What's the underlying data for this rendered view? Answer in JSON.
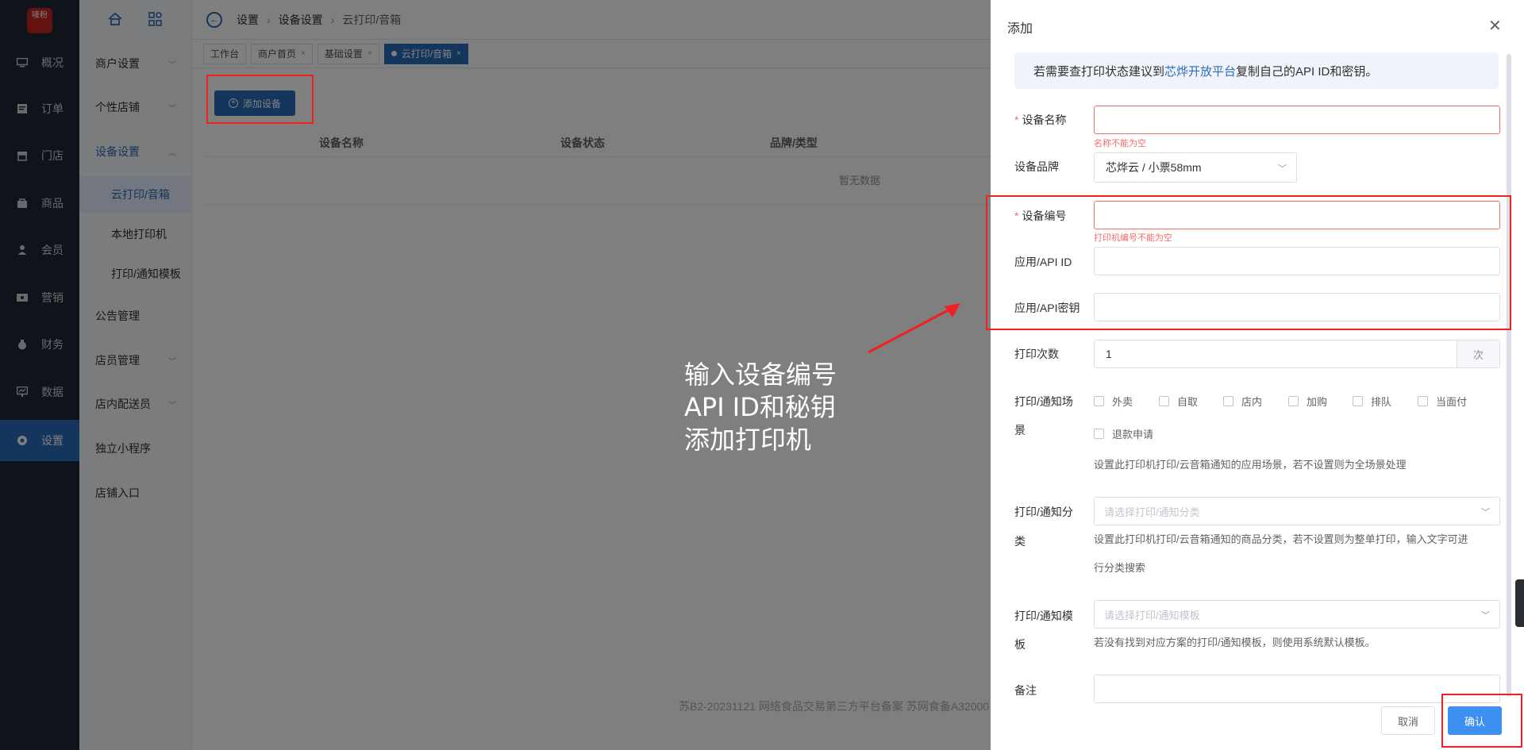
{
  "nav": {
    "logo_text": "唛粉",
    "items": [
      {
        "label": "概况",
        "icon": "monitor-icon"
      },
      {
        "label": "订单",
        "icon": "order-icon"
      },
      {
        "label": "门店",
        "icon": "store-icon"
      },
      {
        "label": "商品",
        "icon": "bag-icon"
      },
      {
        "label": "会员",
        "icon": "user-icon"
      },
      {
        "label": "营销",
        "icon": "ticket-icon"
      },
      {
        "label": "财务",
        "icon": "money-bag-icon"
      },
      {
        "label": "数据",
        "icon": "chart-screen-icon"
      },
      {
        "label": "设置",
        "icon": "gear-icon"
      }
    ]
  },
  "subnav": {
    "items": [
      {
        "label": "商户设置"
      },
      {
        "label": "个性店铺"
      },
      {
        "label": "设备设置"
      },
      {
        "label": "公告管理"
      },
      {
        "label": "店员管理"
      },
      {
        "label": "店内配送员"
      },
      {
        "label": "独立小程序"
      },
      {
        "label": "店铺入口"
      }
    ],
    "children": [
      "云打印/音箱",
      "本地打印机",
      "打印/通知模板"
    ]
  },
  "breadcrumb": [
    "设置",
    "设备设置",
    "云打印/音箱"
  ],
  "tabs": [
    {
      "label": "工作台"
    },
    {
      "label": "商户首页"
    },
    {
      "label": "基础设置"
    },
    {
      "label": "云打印/音箱"
    }
  ],
  "page": {
    "add_button": "添加设备",
    "columns": [
      "设备名称",
      "设备状态",
      "品牌/类型"
    ],
    "empty": "暂无数据",
    "footer": "苏B2-20231121  网络食品交易第三方平台备案 苏网食备A32000"
  },
  "annotation": {
    "lines": [
      "输入设备编号",
      "API ID和秘钥",
      "添加打印机"
    ]
  },
  "drawer": {
    "title": "添加",
    "notice_prefix": "若需要查打印状态建议到",
    "notice_link": "芯烨开放平台",
    "notice_suffix": "复制自己的API ID和密钥。",
    "device_name_label": "设备名称",
    "device_name_error": "名称不能为空",
    "brand_label": "设备品牌",
    "brand_value": "芯烨云 / 小票58mm",
    "device_no_label": "设备编号",
    "device_no_error": "打印机编号不能为空",
    "api_id_label": "应用/API ID",
    "api_key_label": "应用/API密钥",
    "print_count_label": "打印次数",
    "print_count_value": "1",
    "print_count_unit": "次",
    "scene_label_1": "打印/通知场",
    "scene_label_2": "景",
    "scenes": [
      "外卖",
      "自取",
      "店内",
      "加购",
      "排队",
      "当面付",
      "退款申请"
    ],
    "scene_hint": "设置此打印机打印/云音箱通知的应用场景，若不设置则为全场景处理",
    "category_label_1": "打印/通知分",
    "category_label_2": "类",
    "category_placeholder": "请选择打印/通知分类",
    "category_hint_1": "设置此打印机打印/云音箱通知的商品分类，若不设置则为整单打印，输入文字可进",
    "category_hint_2": "行分类搜索",
    "template_label_1": "打印/通知模",
    "template_label_2": "板",
    "template_placeholder": "请选择打印/通知模板",
    "template_hint": "若没有找到对应方案的打印/通知模板，则使用系统默认模板。",
    "remark_label": "备注",
    "cancel": "取消",
    "confirm": "确认"
  },
  "colors": {
    "accent": "#2a6db8",
    "nav_bg": "#1f2935",
    "error": "#f56c6c",
    "annotation_red": "#f02020"
  }
}
